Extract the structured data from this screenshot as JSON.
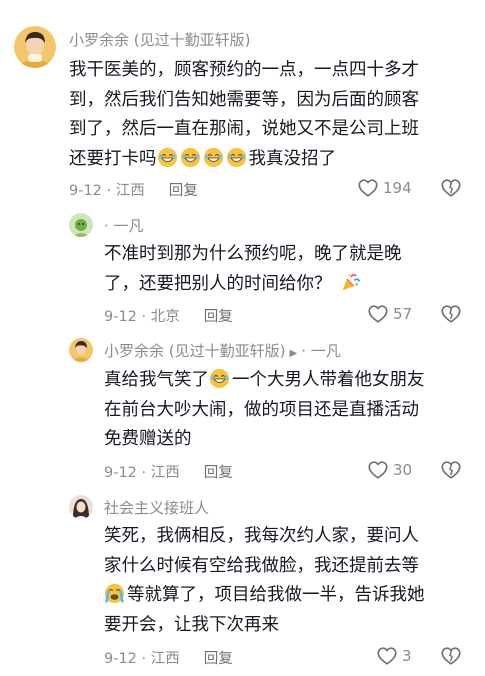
{
  "comments": [
    {
      "username": "小罗余余 (见过十勤亚轩版)",
      "lines": [
        "我干医美的，顾客预约的一点，一点四十多才",
        "到，然后我们告知她需要等，因为后面的顾客",
        "到了，然后一直在那闹，说她又不是公司上班",
        "还要打卡吗"
      ],
      "line4_suffix": "我真没招了",
      "date": "9-12 · 江西",
      "reply_label": "回复",
      "likes": "194"
    },
    {
      "username": "· 一凡",
      "lines": [
        "不准时到那为什么预约呢，晚了就是晚",
        "了，还要把别人的时间给你？"
      ],
      "date": "9-12 · 北京",
      "reply_label": "回复",
      "likes": "57"
    },
    {
      "username": "小罗余余 (见过十勤亚轩版)",
      "reply_to": "· 一凡",
      "line1_prefix": "真给我气笑了",
      "line1_suffix": "一个大男人带着他女朋友",
      "lines": [
        "在前台大吵大闹，做的项目还是直播活动",
        "免费赠送的"
      ],
      "date": "9-12 · 江西",
      "reply_label": "回复",
      "likes": "30"
    },
    {
      "username": "社会主义接班人",
      "lines": [
        "笑死，我俩相反，我每次约人家，要问人",
        "家什么时候有空给我做脸，我还提前去等"
      ],
      "line3_suffix": "等就算了，项目给我做一半，告诉我她",
      "line4": "要开会，让我下次再来",
      "date": "9-12 · 江西",
      "reply_label": "回复",
      "likes": "3"
    }
  ],
  "colors": {
    "text": "#161823",
    "secondary": "#8a8b91",
    "emoji": "#f6c343"
  },
  "icons": [
    "heart-outline-icon",
    "dislike-heart-icon",
    "grin-emoji-icon",
    "crying-emoji-icon",
    "party-popper-icon",
    "play-arrow-icon"
  ]
}
